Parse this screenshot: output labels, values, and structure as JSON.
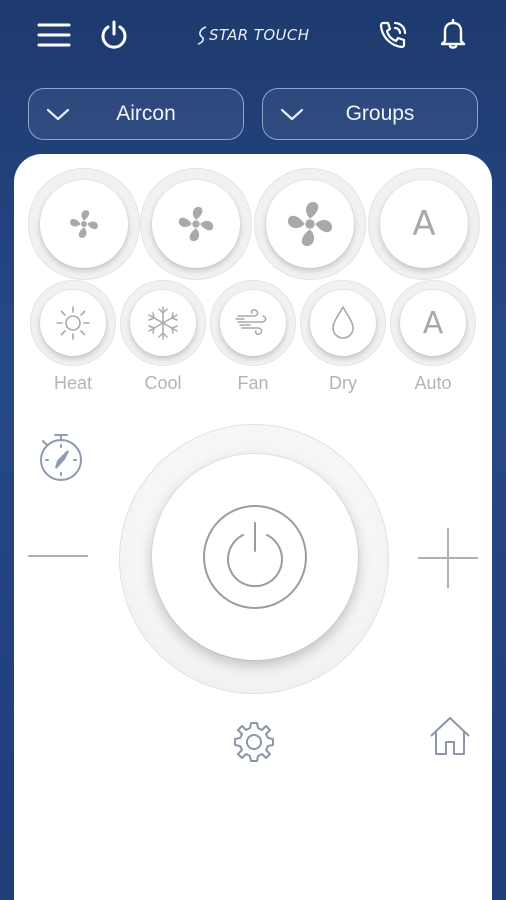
{
  "app": {
    "brand": "STAR TOUCH"
  },
  "topbar": {
    "menu_icon": "hamburger-icon",
    "power_icon": "power-icon",
    "call_icon": "phone-call-icon",
    "bell_icon": "bell-icon"
  },
  "dropdowns": [
    {
      "label": "Aircon"
    },
    {
      "label": "Groups"
    }
  ],
  "fan_speeds": [
    {
      "name": "fan-low",
      "icon": "fan-small-icon"
    },
    {
      "name": "fan-medium",
      "icon": "fan-medium-icon"
    },
    {
      "name": "fan-high",
      "icon": "fan-large-icon"
    },
    {
      "name": "fan-auto",
      "letter": "A"
    }
  ],
  "modes": [
    {
      "label": "Heat",
      "icon": "sun-icon"
    },
    {
      "label": "Cool",
      "icon": "snowflake-icon"
    },
    {
      "label": "Fan",
      "icon": "wind-icon"
    },
    {
      "label": "Dry",
      "icon": "droplet-icon"
    },
    {
      "label": "Auto",
      "letter": "A"
    }
  ],
  "controls": {
    "timer_icon": "stopwatch-icon",
    "minus_icon": "minus-icon",
    "plus_icon": "plus-icon",
    "power_icon": "power-button-icon",
    "settings_icon": "gear-icon",
    "home_icon": "home-icon"
  },
  "colors": {
    "background_top": "#1e3a6e",
    "background_bottom": "#1f3d77",
    "panel": "#ffffff",
    "icon_gray": "#a9a9a9"
  }
}
